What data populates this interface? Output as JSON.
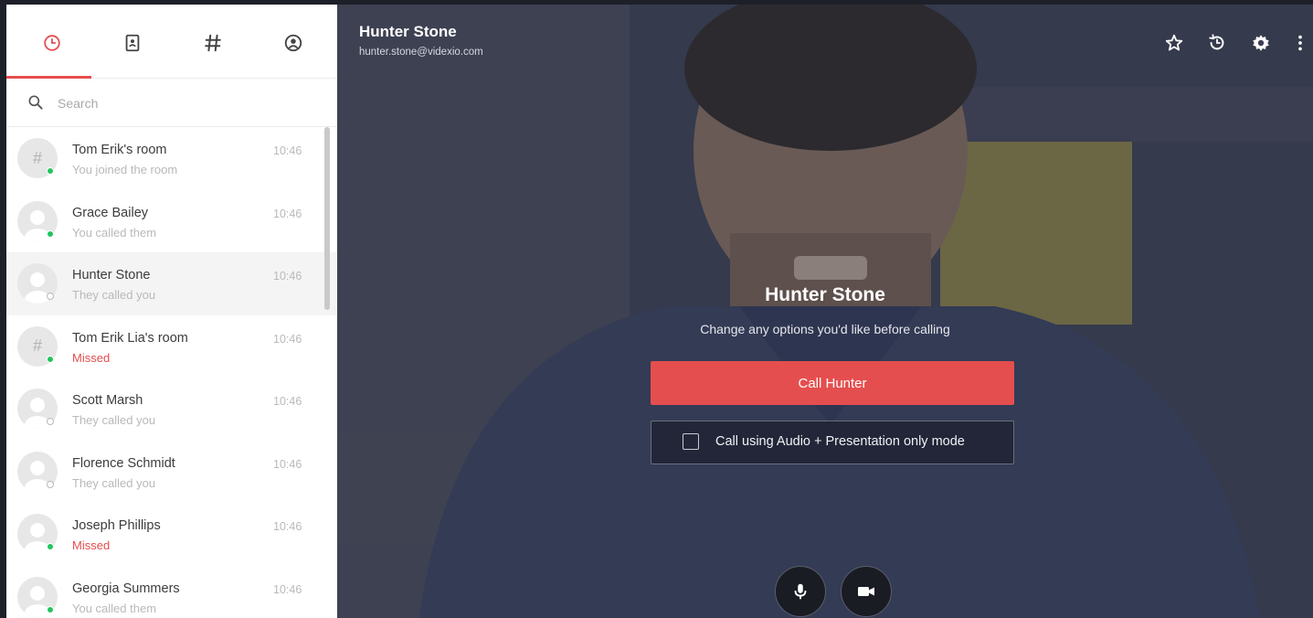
{
  "sidebar": {
    "tabs": [
      {
        "name": "recent",
        "icon": "clock-icon",
        "active": true
      },
      {
        "name": "contacts",
        "icon": "address-book-icon",
        "active": false
      },
      {
        "name": "rooms",
        "icon": "hash-icon",
        "active": false
      },
      {
        "name": "profile",
        "icon": "user-circle-icon",
        "active": false
      }
    ],
    "search": {
      "placeholder": "Search"
    },
    "items": [
      {
        "name": "Tom Erik's room",
        "subtitle": "You joined the room",
        "time": "10:46",
        "type": "room",
        "status": "online",
        "missed": false
      },
      {
        "name": "Grace Bailey",
        "subtitle": "You called them",
        "time": "10:46",
        "type": "person",
        "status": "online",
        "missed": false
      },
      {
        "name": "Hunter Stone",
        "subtitle": "They called you",
        "time": "10:46",
        "type": "person",
        "status": "offline",
        "missed": false,
        "active": true
      },
      {
        "name": "Tom Erik Lia's room",
        "subtitle": "Missed",
        "time": "10:46",
        "type": "room",
        "status": "online",
        "missed": true
      },
      {
        "name": "Scott Marsh",
        "subtitle": "They called you",
        "time": "10:46",
        "type": "person",
        "status": "offline",
        "missed": false
      },
      {
        "name": "Florence Schmidt",
        "subtitle": "They called you",
        "time": "10:46",
        "type": "person",
        "status": "offline",
        "missed": false
      },
      {
        "name": "Joseph Phillips",
        "subtitle": "Missed",
        "time": "10:46",
        "type": "person",
        "status": "online",
        "missed": true
      },
      {
        "name": "Georgia Summers",
        "subtitle": "You called them",
        "time": "10:46",
        "type": "person",
        "status": "online",
        "missed": false
      }
    ]
  },
  "header": {
    "name": "Hunter Stone",
    "email": "hunter.stone@videxio.com",
    "icons": [
      "star-icon",
      "history-icon",
      "gear-icon",
      "more-vertical-icon"
    ]
  },
  "dialog": {
    "title": "Hunter Stone",
    "subtitle": "Change any options you'd like before calling",
    "call_label": "Call Hunter",
    "audio_only_label": "Call using Audio + Presentation only mode",
    "audio_only_checked": false
  },
  "controls": {
    "icons": [
      "microphone-icon",
      "video-camera-icon"
    ]
  },
  "colors": {
    "accent": "#e54e4e",
    "online": "#22c55e",
    "sidebar_bg": "#ffffff",
    "main_bg": "#3a3f52"
  }
}
